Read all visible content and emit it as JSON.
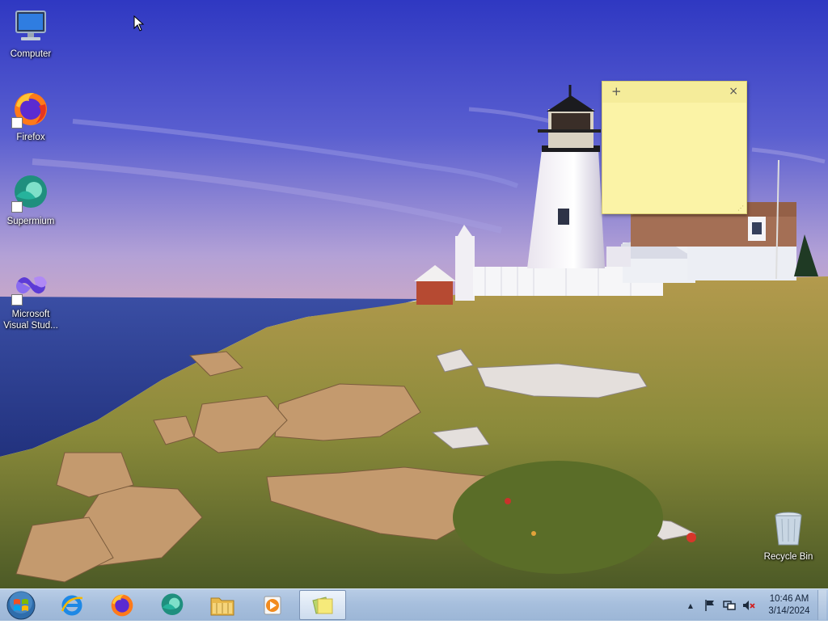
{
  "desktop": {
    "icons": [
      {
        "name": "computer",
        "label": "Computer"
      },
      {
        "name": "firefox",
        "label": "Firefox"
      },
      {
        "name": "supermium",
        "label": "Supermium"
      },
      {
        "name": "visual-studio",
        "label": "Microsoft Visual Stud..."
      },
      {
        "name": "recycle-bin",
        "label": "Recycle Bin"
      }
    ]
  },
  "sticky_note": {
    "add_symbol": "+",
    "close_symbol": "×",
    "content": ""
  },
  "taskbar": {
    "pinned": [
      {
        "name": "internet-explorer",
        "icon": "internet-explorer-icon"
      },
      {
        "name": "firefox",
        "icon": "firefox-icon"
      },
      {
        "name": "supermium",
        "icon": "supermium-icon"
      },
      {
        "name": "windows-explorer",
        "icon": "folder-icon"
      },
      {
        "name": "media-player",
        "icon": "media-player-icon"
      },
      {
        "name": "sticky-notes",
        "icon": "sticky-notes-icon",
        "active": true
      }
    ],
    "tray": {
      "show_hidden_symbol": "▲",
      "time": "10:46 AM",
      "date": "3/14/2024"
    }
  },
  "colors": {
    "sky_top": "#3a44c8",
    "sky_horizon": "#b1a2d6",
    "sea": "#2a3e98",
    "grass": "#a98c3f",
    "sticky_yellow": "#fbf3a6",
    "taskbar": "#a7bfdd"
  }
}
